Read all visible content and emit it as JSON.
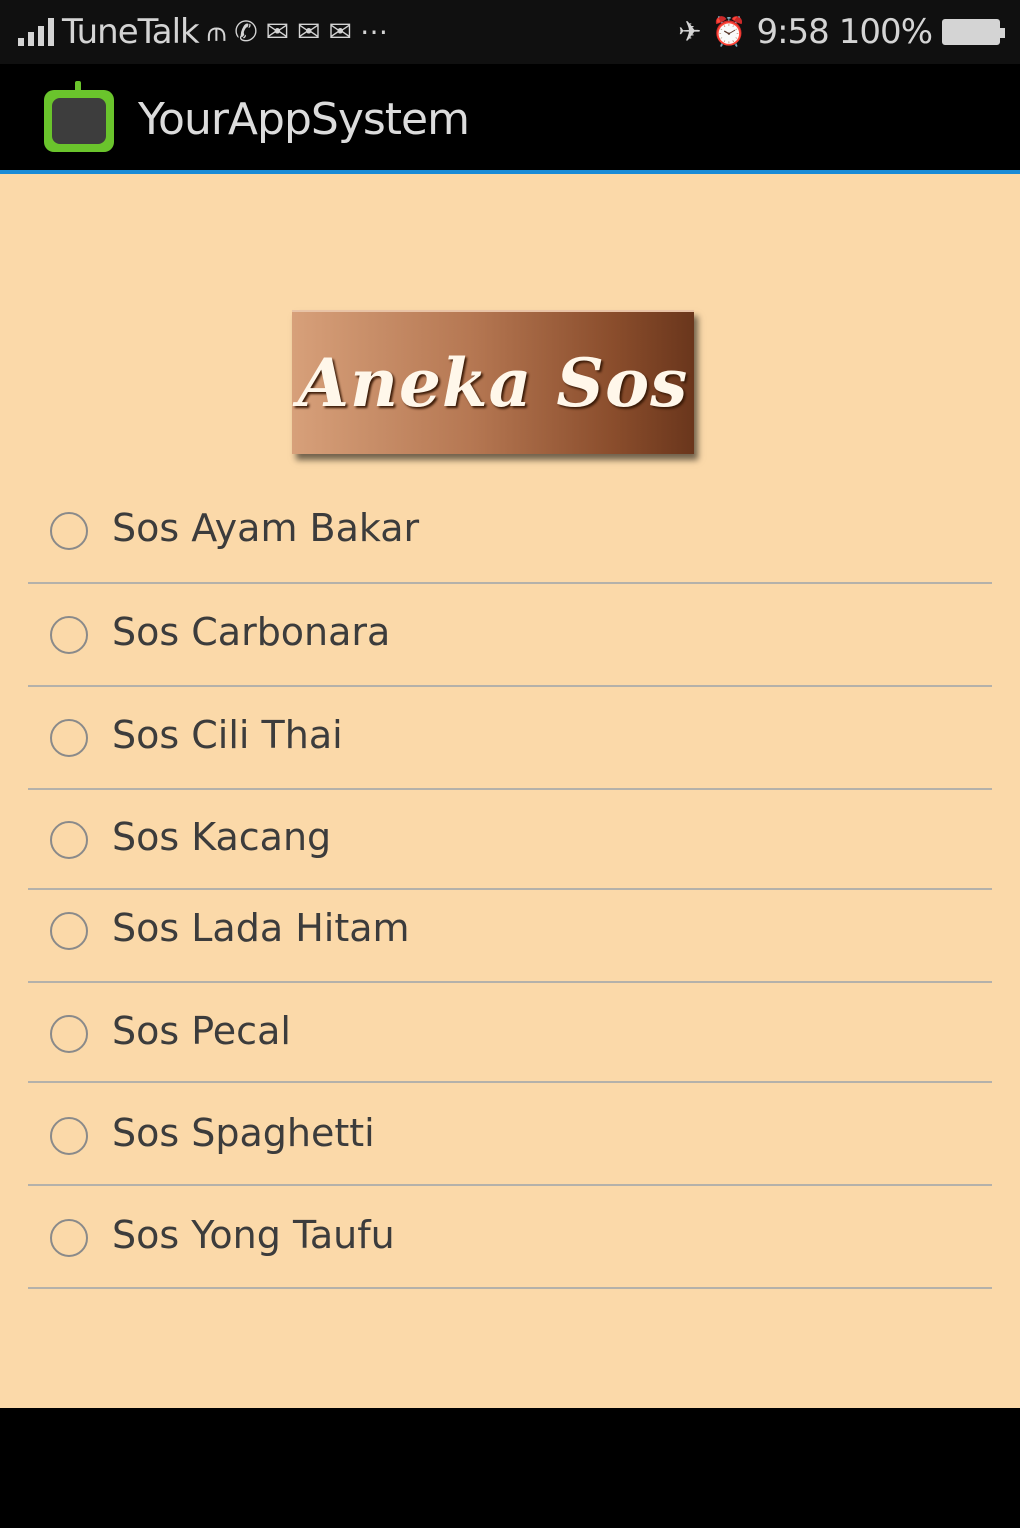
{
  "status_bar": {
    "carrier": "TuneTalk",
    "time": "9:58",
    "battery_percent": "100%",
    "notification_icons": [
      "wifi-icon",
      "whatsapp-icon",
      "mail-icon",
      "mail-icon",
      "gmail-icon",
      "more-dots-icon"
    ],
    "system_icons": [
      "airplane-mute-icon",
      "alarm-icon"
    ]
  },
  "action_bar": {
    "title": "YourAppSystem",
    "icon": "android-app-icon"
  },
  "banner": {
    "text": "Aneka Sos"
  },
  "options": [
    {
      "label": "Sos Ayam Bakar",
      "selected": false
    },
    {
      "label": "Sos Carbonara",
      "selected": false
    },
    {
      "label": "Sos Cili Thai",
      "selected": false
    },
    {
      "label": "Sos Kacang",
      "selected": false
    },
    {
      "label": "Sos Lada Hitam",
      "selected": false
    },
    {
      "label": "Sos Pecal",
      "selected": false
    },
    {
      "label": "Sos Spaghetti",
      "selected": false
    },
    {
      "label": "Sos Yong Taufu",
      "selected": false
    }
  ],
  "colors": {
    "background": "#fbd9a9",
    "action_bar_accent": "#1a8bd6",
    "banner_brown": "#8a4d2c"
  }
}
